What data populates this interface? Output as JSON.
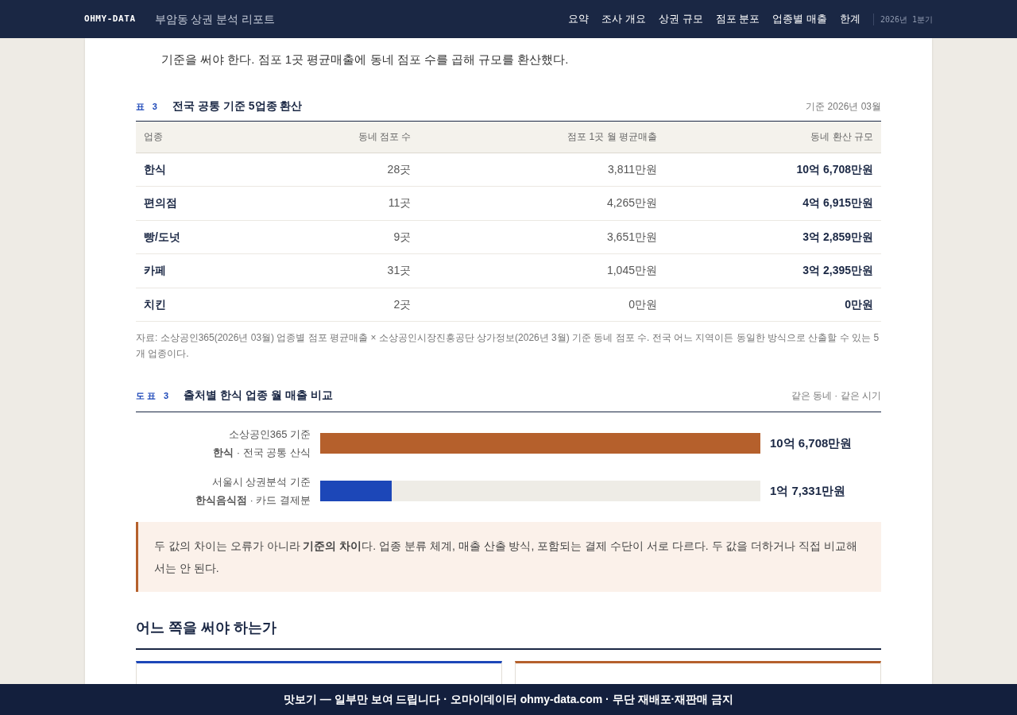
{
  "header": {
    "brand": "OHMY-DATA",
    "title": "부암동 상권 분석 리포트",
    "nav": [
      {
        "label": "요약"
      },
      {
        "label": "조사 개요"
      },
      {
        "label": "상권 규모"
      },
      {
        "label": "점포 분포"
      },
      {
        "label": "업종별 매출"
      },
      {
        "label": "한계"
      }
    ],
    "period": "2026년 1분기"
  },
  "intro": "기준을 써야 한다. 점포 1곳 평균매출에 동네 점포 수를 곱해 규모를 환산했다.",
  "table": {
    "tag": "표 3",
    "title": "전국 공통 기준 5업종 환산",
    "note": "기준 2026년 03월",
    "columns": [
      "업종",
      "동네 점포 수",
      "점포 1곳 월 평균매출",
      "동네 환산 규모"
    ],
    "rows": [
      [
        "한식",
        "28곳",
        "3,811만원",
        "10억 6,708만원"
      ],
      [
        "편의점",
        "11곳",
        "4,265만원",
        "4억 6,915만원"
      ],
      [
        "빵/도넛",
        "9곳",
        "3,651만원",
        "3억 2,859만원"
      ],
      [
        "카페",
        "31곳",
        "1,045만원",
        "3억 2,395만원"
      ],
      [
        "치킨",
        "2곳",
        "0만원",
        "0만원"
      ]
    ],
    "source": "자료: 소상공인365(2026년 03월) 업종별 점포 평균매출 × 소상공인시장진흥공단 상가정보(2026년 3월) 기준 동네 점포 수. 전국 어느 지역이든 동일한 방식으로 산출할 수 있는 5개 업종이다."
  },
  "figure": {
    "tag": "도표 3",
    "title": "출처별 한식 업종 월 매출 비교",
    "note": "같은 동네 · 같은 시기",
    "bars": [
      {
        "source": "소상공인365 기준",
        "category": "**한식** · 전국 공통 산식",
        "level": 1,
        "color": "#b5602c",
        "value": "10억 6,708만원"
      },
      {
        "source": "서울시 상권분석 기준",
        "category": "**한식음식점** · 카드 결제분",
        "level": 0.162,
        "color": "#1c47b8",
        "value": "1억 7,331만원"
      }
    ]
  },
  "callout": "두 값의 차이는 오류가 아니라 **기준의 차이**다. 업종 분류 체계, 매출 산출 방식, 포함되는 결제 수단이 서로 다르다. 두 값을 더하거나 직접 비교해서는 안 된다.",
  "section": {
    "title": "어느 쪽을 써야 하는가",
    "cards": [
      {
        "color": "#1c47b8"
      },
      {
        "color": "#b5602c"
      }
    ]
  },
  "footer": "맛보기 — 일부만 보여 드립니다 · 오마이데이터 ohmy-data.com · 무단 재배포·재판매 금지"
}
